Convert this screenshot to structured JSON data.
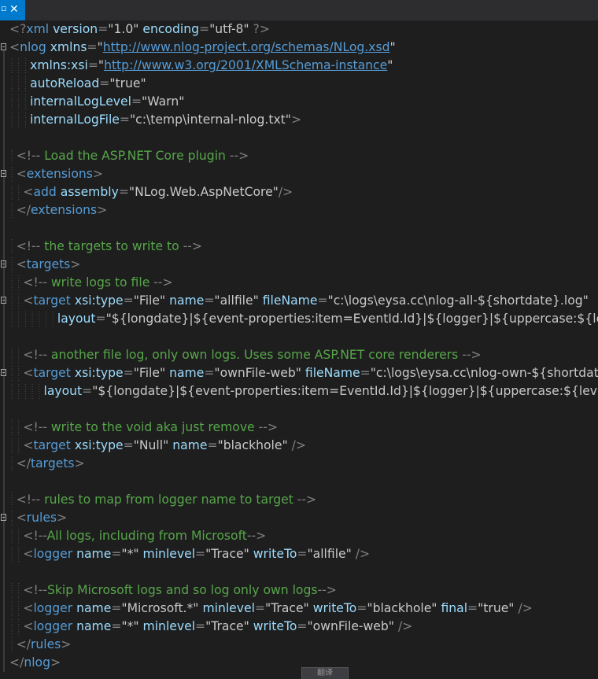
{
  "tab": {
    "pin_glyph": "▫",
    "close_glyph": "✕"
  },
  "lines": [
    {
      "indent": 0,
      "fold": false,
      "tokens": [
        [
          "p",
          "<?"
        ],
        [
          "t",
          "xml"
        ],
        [
          "a",
          " version"
        ],
        [
          "p",
          "="
        ],
        [
          "v",
          "\"1.0\""
        ],
        [
          "a",
          " encoding"
        ],
        [
          "p",
          "="
        ],
        [
          "v",
          "\"utf-8\""
        ],
        [
          "p",
          " ?>"
        ]
      ]
    },
    {
      "indent": 0,
      "fold": true,
      "tokens": [
        [
          "p",
          "<"
        ],
        [
          "t",
          "nlog"
        ],
        [
          "a",
          " xmlns"
        ],
        [
          "p",
          "="
        ],
        [
          "v",
          "\""
        ],
        [
          "u",
          "http://www.nlog-project.org/schemas/NLog.xsd"
        ],
        [
          "v",
          "\""
        ]
      ]
    },
    {
      "indent": 3,
      "fold": false,
      "tokens": [
        [
          "a",
          "xmlns:xsi"
        ],
        [
          "p",
          "="
        ],
        [
          "v",
          "\""
        ],
        [
          "u",
          "http://www.w3.org/2001/XMLSchema-instance"
        ],
        [
          "v",
          "\""
        ]
      ]
    },
    {
      "indent": 3,
      "fold": false,
      "tokens": [
        [
          "a",
          "autoReload"
        ],
        [
          "p",
          "="
        ],
        [
          "v",
          "\"true\""
        ]
      ]
    },
    {
      "indent": 3,
      "fold": false,
      "tokens": [
        [
          "a",
          "internalLogLevel"
        ],
        [
          "p",
          "="
        ],
        [
          "v",
          "\"Warn\""
        ]
      ]
    },
    {
      "indent": 3,
      "fold": false,
      "tokens": [
        [
          "a",
          "internalLogFile"
        ],
        [
          "p",
          "="
        ],
        [
          "v",
          "\"c:\\temp\\internal-nlog.txt\""
        ],
        [
          "p",
          ">"
        ]
      ]
    },
    {
      "indent": 0,
      "fold": false,
      "tokens": []
    },
    {
      "indent": 1,
      "fold": false,
      "tokens": [
        [
          "p",
          "<!--"
        ],
        [
          "c",
          " Load the ASP.NET Core plugin "
        ],
        [
          "p",
          "-->"
        ]
      ]
    },
    {
      "indent": 1,
      "fold": true,
      "tokens": [
        [
          "p",
          "<"
        ],
        [
          "t",
          "extensions"
        ],
        [
          "p",
          ">"
        ]
      ]
    },
    {
      "indent": 2,
      "fold": false,
      "tokens": [
        [
          "p",
          "<"
        ],
        [
          "t",
          "add"
        ],
        [
          "a",
          " assembly"
        ],
        [
          "p",
          "="
        ],
        [
          "v",
          "\"NLog.Web.AspNetCore\""
        ],
        [
          "p",
          "/>"
        ]
      ]
    },
    {
      "indent": 1,
      "fold": false,
      "tokens": [
        [
          "p",
          "</"
        ],
        [
          "t",
          "extensions"
        ],
        [
          "p",
          ">"
        ]
      ]
    },
    {
      "indent": 0,
      "fold": false,
      "tokens": []
    },
    {
      "indent": 1,
      "fold": false,
      "tokens": [
        [
          "p",
          "<!--"
        ],
        [
          "c",
          " the targets to write to "
        ],
        [
          "p",
          "-->"
        ]
      ]
    },
    {
      "indent": 1,
      "fold": true,
      "tokens": [
        [
          "p",
          "<"
        ],
        [
          "t",
          "targets"
        ],
        [
          "p",
          ">"
        ]
      ]
    },
    {
      "indent": 2,
      "fold": false,
      "tokens": [
        [
          "p",
          "<!--"
        ],
        [
          "c",
          " write logs to file "
        ],
        [
          "p",
          "-->"
        ]
      ]
    },
    {
      "indent": 2,
      "fold": true,
      "tokens": [
        [
          "p",
          "<"
        ],
        [
          "t",
          "target"
        ],
        [
          "a",
          " xsi:type"
        ],
        [
          "p",
          "="
        ],
        [
          "v",
          "\"File\""
        ],
        [
          "a",
          " name"
        ],
        [
          "p",
          "="
        ],
        [
          "v",
          "\"allfile\""
        ],
        [
          "a",
          " fileName"
        ],
        [
          "p",
          "="
        ],
        [
          "v",
          "\"c:\\logs\\eysa.cc\\nlog-all-${shortdate}.log\""
        ]
      ]
    },
    {
      "indent": 7,
      "fold": false,
      "tokens": [
        [
          "a",
          "layout"
        ],
        [
          "p",
          "="
        ],
        [
          "v",
          "\"${longdate}|${event-properties:item=EventId.Id}|${logger}|${uppercase:${level}"
        ]
      ]
    },
    {
      "indent": 0,
      "fold": false,
      "tokens": []
    },
    {
      "indent": 2,
      "fold": false,
      "tokens": [
        [
          "p",
          "<!--"
        ],
        [
          "c",
          " another file log, only own logs. Uses some ASP.NET core renderers "
        ],
        [
          "p",
          "-->"
        ]
      ]
    },
    {
      "indent": 2,
      "fold": true,
      "tokens": [
        [
          "p",
          "<"
        ],
        [
          "t",
          "target"
        ],
        [
          "a",
          " xsi:type"
        ],
        [
          "p",
          "="
        ],
        [
          "v",
          "\"File\""
        ],
        [
          "a",
          " name"
        ],
        [
          "p",
          "="
        ],
        [
          "v",
          "\"ownFile-web\""
        ],
        [
          "a",
          " fileName"
        ],
        [
          "p",
          "="
        ],
        [
          "v",
          "\"c:\\logs\\eysa.cc\\nlog-own-${shortdate"
        ]
      ]
    },
    {
      "indent": 5,
      "fold": false,
      "tokens": [
        [
          "a",
          "layout"
        ],
        [
          "p",
          "="
        ],
        [
          "v",
          "\"${longdate}|${event-properties:item=EventId.Id}|${logger}|${uppercase:${level}}|"
        ]
      ]
    },
    {
      "indent": 0,
      "fold": false,
      "tokens": []
    },
    {
      "indent": 2,
      "fold": false,
      "tokens": [
        [
          "p",
          "<!--"
        ],
        [
          "c",
          " write to the void aka just remove "
        ],
        [
          "p",
          "-->"
        ]
      ]
    },
    {
      "indent": 2,
      "fold": false,
      "tokens": [
        [
          "p",
          "<"
        ],
        [
          "t",
          "target"
        ],
        [
          "a",
          " xsi:type"
        ],
        [
          "p",
          "="
        ],
        [
          "v",
          "\"Null\""
        ],
        [
          "a",
          " name"
        ],
        [
          "p",
          "="
        ],
        [
          "v",
          "\"blackhole\""
        ],
        [
          "p",
          " />"
        ]
      ]
    },
    {
      "indent": 1,
      "fold": false,
      "tokens": [
        [
          "p",
          "</"
        ],
        [
          "t",
          "targets"
        ],
        [
          "p",
          ">"
        ]
      ]
    },
    {
      "indent": 0,
      "fold": false,
      "tokens": []
    },
    {
      "indent": 1,
      "fold": false,
      "tokens": [
        [
          "p",
          "<!--"
        ],
        [
          "c",
          " rules to map from logger name to target "
        ],
        [
          "p",
          "-->"
        ]
      ]
    },
    {
      "indent": 1,
      "fold": true,
      "tokens": [
        [
          "p",
          "<"
        ],
        [
          "t",
          "rules"
        ],
        [
          "p",
          ">"
        ]
      ]
    },
    {
      "indent": 2,
      "fold": false,
      "tokens": [
        [
          "p",
          "<!--"
        ],
        [
          "c",
          "All logs, including from Microsoft"
        ],
        [
          "p",
          "-->"
        ]
      ]
    },
    {
      "indent": 2,
      "fold": false,
      "tokens": [
        [
          "p",
          "<"
        ],
        [
          "t",
          "logger"
        ],
        [
          "a",
          " name"
        ],
        [
          "p",
          "="
        ],
        [
          "v",
          "\"*\""
        ],
        [
          "a",
          " minlevel"
        ],
        [
          "p",
          "="
        ],
        [
          "v",
          "\"Trace\""
        ],
        [
          "a",
          " writeTo"
        ],
        [
          "p",
          "="
        ],
        [
          "v",
          "\"allfile\""
        ],
        [
          "p",
          " />"
        ]
      ]
    },
    {
      "indent": 0,
      "fold": false,
      "tokens": []
    },
    {
      "indent": 2,
      "fold": false,
      "tokens": [
        [
          "p",
          "<!--"
        ],
        [
          "c",
          "Skip Microsoft logs and so log only own logs"
        ],
        [
          "p",
          "-->"
        ]
      ]
    },
    {
      "indent": 2,
      "fold": false,
      "tokens": [
        [
          "p",
          "<"
        ],
        [
          "t",
          "logger"
        ],
        [
          "a",
          " name"
        ],
        [
          "p",
          "="
        ],
        [
          "v",
          "\"Microsoft.*\""
        ],
        [
          "a",
          " minlevel"
        ],
        [
          "p",
          "="
        ],
        [
          "v",
          "\"Trace\""
        ],
        [
          "a",
          " writeTo"
        ],
        [
          "p",
          "="
        ],
        [
          "v",
          "\"blackhole\""
        ],
        [
          "a",
          " final"
        ],
        [
          "p",
          "="
        ],
        [
          "v",
          "\"true\""
        ],
        [
          "p",
          " />"
        ]
      ]
    },
    {
      "indent": 2,
      "fold": false,
      "tokens": [
        [
          "p",
          "<"
        ],
        [
          "t",
          "logger"
        ],
        [
          "a",
          " name"
        ],
        [
          "p",
          "="
        ],
        [
          "v",
          "\"*\""
        ],
        [
          "a",
          " minlevel"
        ],
        [
          "p",
          "="
        ],
        [
          "v",
          "\"Trace\""
        ],
        [
          "a",
          " writeTo"
        ],
        [
          "p",
          "="
        ],
        [
          "v",
          "\"ownFile-web\""
        ],
        [
          "p",
          " />"
        ]
      ]
    },
    {
      "indent": 1,
      "fold": false,
      "tokens": [
        [
          "p",
          "</"
        ],
        [
          "t",
          "rules"
        ],
        [
          "p",
          ">"
        ]
      ]
    },
    {
      "indent": 0,
      "fold": false,
      "tokens": [
        [
          "p",
          "</"
        ],
        [
          "t",
          "nlog"
        ],
        [
          "p",
          ">"
        ]
      ]
    }
  ],
  "translate_button": {
    "label": "翻译"
  }
}
